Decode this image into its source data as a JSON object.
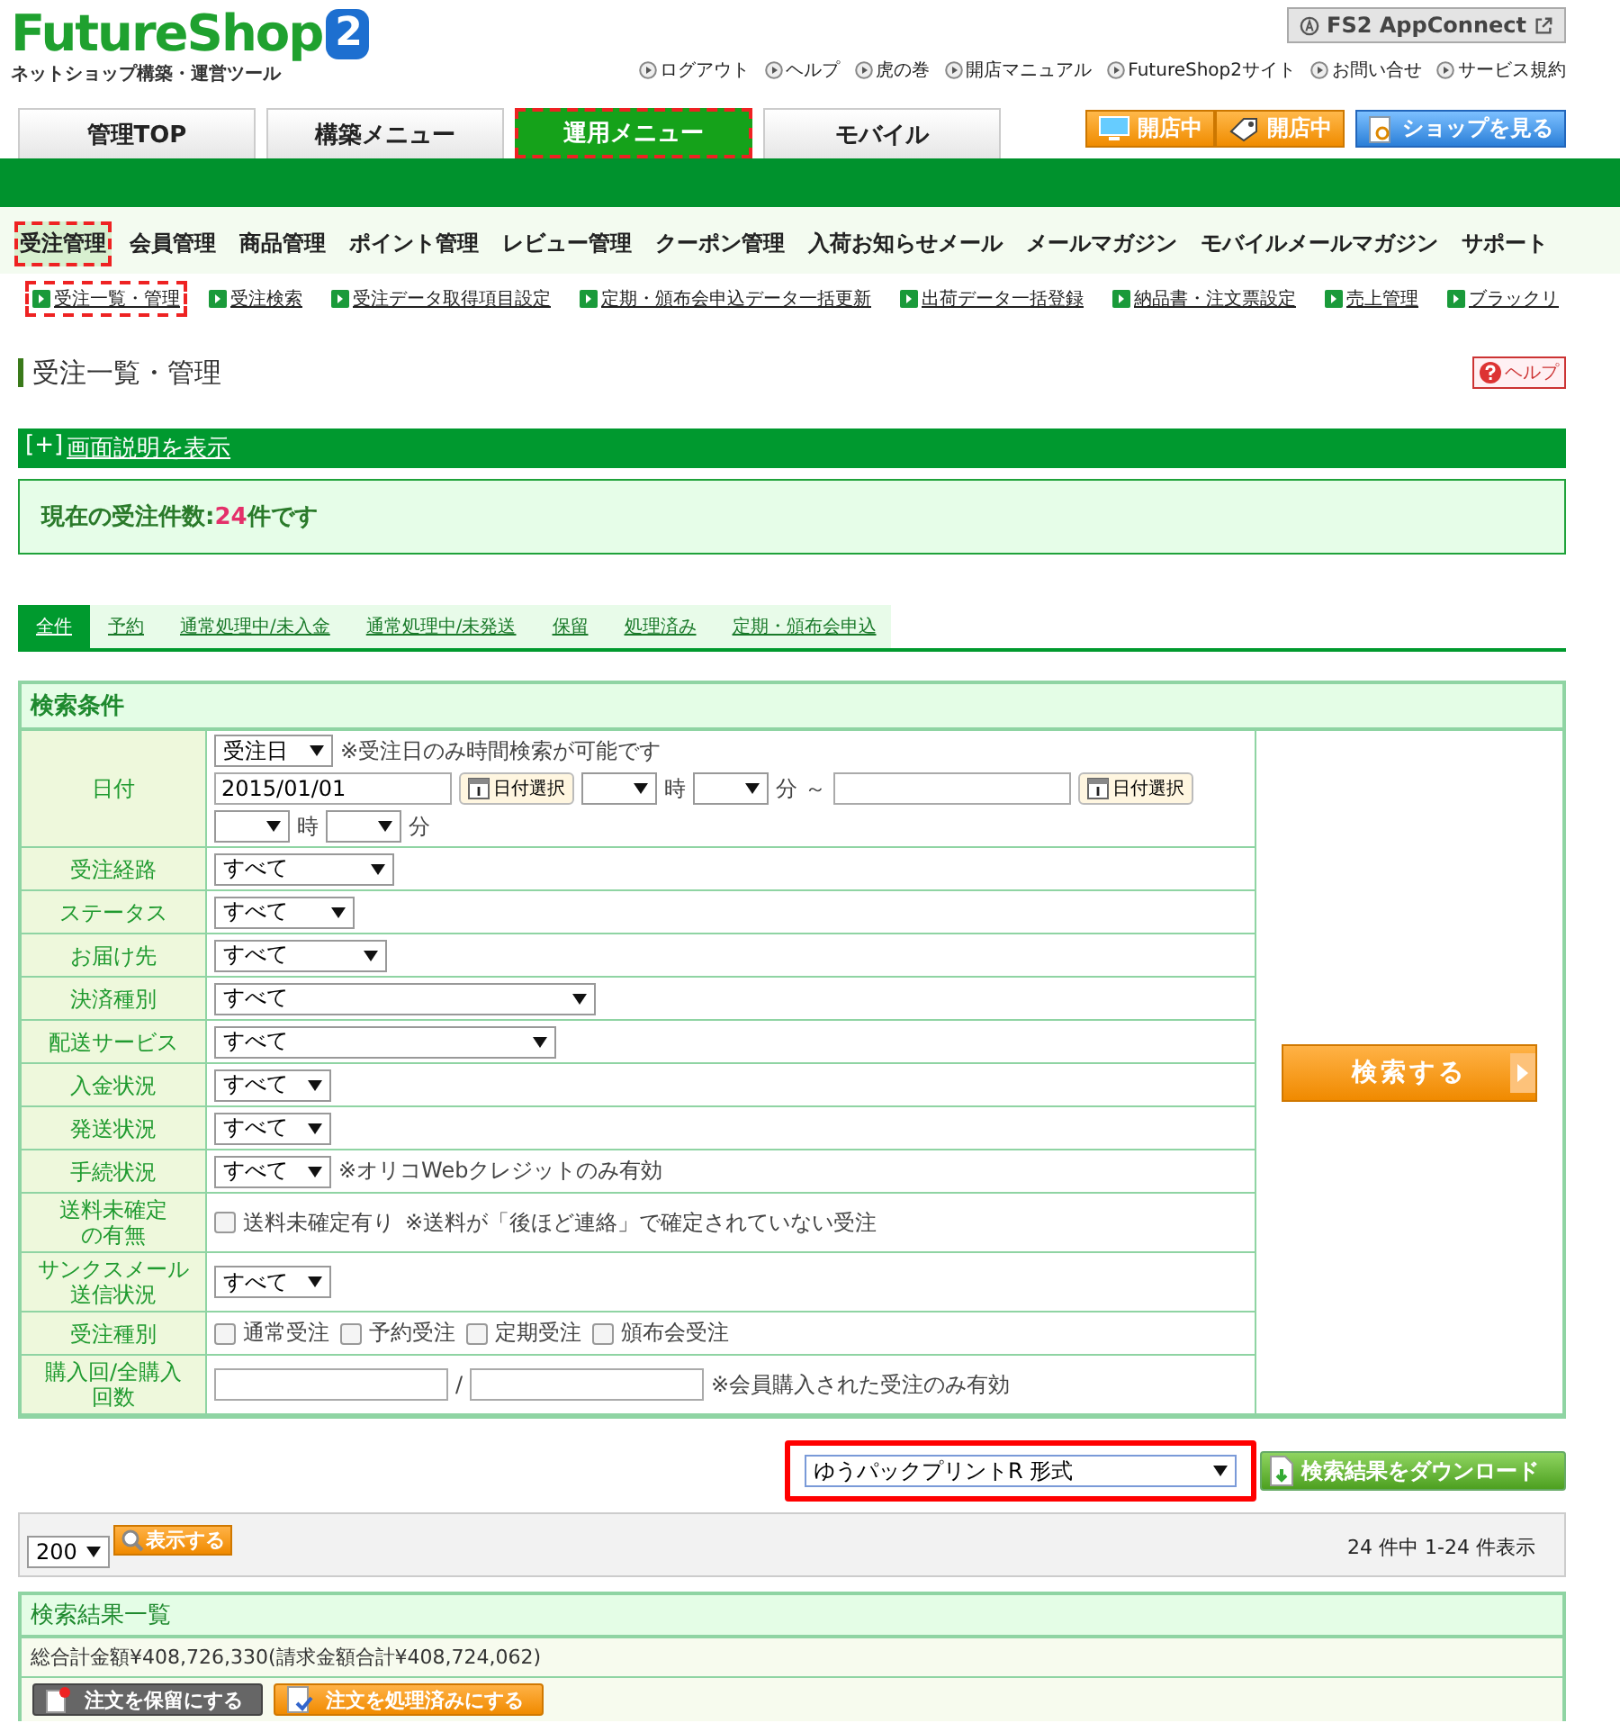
{
  "logo": {
    "name": "FutureShop",
    "badge": "2",
    "tagline": "ネットショップ構築・運営ツール"
  },
  "app_connect": "FS2 AppConnect",
  "top_links": [
    "ログアウト",
    "ヘルプ",
    "虎の巻",
    "開店マニュアル",
    "FutureShop2サイト",
    "お問い合せ",
    "サービス規約"
  ],
  "main_tabs": [
    {
      "label": "管理TOP",
      "selected": false,
      "highlighted": false
    },
    {
      "label": "構築メニュー",
      "selected": false,
      "highlighted": false
    },
    {
      "label": "運用メニュー",
      "selected": true,
      "highlighted": true
    },
    {
      "label": "モバイル",
      "selected": false,
      "highlighted": false
    }
  ],
  "shop_status": [
    "開店中",
    "開店中"
  ],
  "view_shop": "ショップを見る",
  "nav": [
    {
      "label": "受注管理",
      "selected": true,
      "highlighted": true
    },
    {
      "label": "会員管理",
      "selected": false,
      "highlighted": false
    },
    {
      "label": "商品管理",
      "selected": false,
      "highlighted": false
    },
    {
      "label": "ポイント管理",
      "selected": false,
      "highlighted": false
    },
    {
      "label": "レビュー管理",
      "selected": false,
      "highlighted": false
    },
    {
      "label": "クーポン管理",
      "selected": false,
      "highlighted": false
    },
    {
      "label": "入荷お知らせメール",
      "selected": false,
      "highlighted": false
    },
    {
      "label": "メールマガジン",
      "selected": false,
      "highlighted": false
    },
    {
      "label": "モバイルメールマガジン",
      "selected": false,
      "highlighted": false
    },
    {
      "label": "サポート",
      "selected": false,
      "highlighted": false
    }
  ],
  "subnav": [
    {
      "label": "受注一覧・管理",
      "highlighted": true
    },
    {
      "label": "受注検索",
      "highlighted": false
    },
    {
      "label": "受注データ取得項目設定",
      "highlighted": false
    },
    {
      "label": "定期・頒布会申込データ一括更新",
      "highlighted": false
    },
    {
      "label": "出荷データ一括登録",
      "highlighted": false
    },
    {
      "label": "納品書・注文票設定",
      "highlighted": false
    },
    {
      "label": "売上管理",
      "highlighted": false
    },
    {
      "label": "ブラックリ",
      "highlighted": false
    }
  ],
  "page_title": "受注一覧・管理",
  "help_button": "ヘルプ",
  "explanation": {
    "toggle": "[+]",
    "label": "画面説明を表示"
  },
  "order_count": {
    "prefix": "現在の受注件数:",
    "count": "24",
    "suffix": "件です"
  },
  "status_tabs": [
    {
      "label": "全件",
      "selected": true
    },
    {
      "label": "予約",
      "selected": false
    },
    {
      "label": "通常処理中/未入金",
      "selected": false
    },
    {
      "label": "通常処理中/未発送",
      "selected": false
    },
    {
      "label": "保留",
      "selected": false
    },
    {
      "label": "処理済み",
      "selected": false
    },
    {
      "label": "定期・頒布会申込",
      "selected": false
    }
  ],
  "search": {
    "title": "検索条件",
    "button": "検索する",
    "rows": [
      {
        "label": "日付",
        "lines": [
          [
            {
              "kind": "select",
              "value": "受注日"
            },
            {
              "kind": "note",
              "text": "※受注日のみ時間検索が可能です"
            }
          ],
          [
            {
              "kind": "input",
              "value": "2015/01/01"
            },
            {
              "kind": "date_button",
              "label": "日付選択"
            },
            {
              "kind": "select"
            },
            {
              "kind": "unit",
              "text": "時"
            },
            {
              "kind": "select"
            },
            {
              "kind": "unit",
              "text": "分 ～"
            },
            {
              "kind": "input"
            },
            {
              "kind": "date_button",
              "label": "日付選択"
            }
          ],
          [
            {
              "kind": "select"
            },
            {
              "kind": "unit",
              "text": "時"
            },
            {
              "kind": "select"
            },
            {
              "kind": "unit",
              "text": "分"
            }
          ]
        ]
      },
      {
        "label": "受注経路",
        "lines": [
          [
            {
              "kind": "select",
              "value": "すべて"
            }
          ]
        ]
      },
      {
        "label": "ステータス",
        "lines": [
          [
            {
              "kind": "select",
              "value": "すべて"
            }
          ]
        ]
      },
      {
        "label": "お届け先",
        "lines": [
          [
            {
              "kind": "select",
              "value": "すべて"
            }
          ]
        ]
      },
      {
        "label": "決済種別",
        "lines": [
          [
            {
              "kind": "select",
              "value": "すべて"
            }
          ]
        ]
      },
      {
        "label": "配送サービス",
        "lines": [
          [
            {
              "kind": "select",
              "value": "すべて"
            }
          ]
        ]
      },
      {
        "label": "入金状況",
        "lines": [
          [
            {
              "kind": "select",
              "value": "すべて"
            }
          ]
        ]
      },
      {
        "label": "発送状況",
        "lines": [
          [
            {
              "kind": "select",
              "value": "すべて"
            }
          ]
        ]
      },
      {
        "label": "手続状況",
        "lines": [
          [
            {
              "kind": "select",
              "value": "すべて"
            },
            {
              "kind": "note",
              "text": "※オリコWebクレジットのみ有効"
            }
          ]
        ]
      },
      {
        "label": "送料未確定の有無",
        "lines": [
          [
            {
              "kind": "checkbox",
              "label": "送料未確定有り",
              "checked": false
            },
            {
              "kind": "note",
              "text": "※送料が「後ほど連絡」で確定されていない受注"
            }
          ]
        ]
      },
      {
        "label": "サンクスメール送信状況",
        "lines": [
          [
            {
              "kind": "select",
              "value": "すべて"
            }
          ]
        ]
      },
      {
        "label": "受注種別",
        "lines": [
          [
            {
              "kind": "checkbox",
              "label": "通常受注",
              "checked": false
            },
            {
              "kind": "checkbox",
              "label": "予約受注",
              "checked": false
            },
            {
              "kind": "checkbox",
              "label": "定期受注",
              "checked": false
            },
            {
              "kind": "checkbox",
              "label": "頒布会受注",
              "checked": false
            }
          ]
        ]
      },
      {
        "label": "購入回/全購入回数",
        "lines": [
          [
            {
              "kind": "input"
            },
            {
              "kind": "unit",
              "text": "/"
            },
            {
              "kind": "input"
            },
            {
              "kind": "note",
              "text": "※会員購入された受注のみ有効"
            }
          ]
        ]
      }
    ]
  },
  "export": {
    "format": "ゆうパックプリントR 形式",
    "highlighted": true,
    "button": "検索結果をダウンロード"
  },
  "pager": {
    "per_page": "200",
    "show_button": "表示する",
    "summary": "24 件中 1-24 件表示"
  },
  "results": {
    "title": "検索結果一覧",
    "total": "総合計金額¥408,726,330(請求金額合計¥408,724,062)",
    "actions": [
      {
        "kind": "hold",
        "label": "注文を保留にする"
      },
      {
        "kind": "done",
        "label": "注文を処理済みにする"
      }
    ]
  }
}
